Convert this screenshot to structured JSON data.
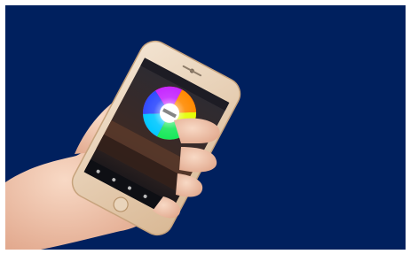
{
  "scene": {
    "background_color": "#00205e",
    "phone_body_color": "#e6c9a8",
    "screen_background": "#1a1a22",
    "hand_skin_color": "#f2c8b0",
    "color_wheel_center_color": "#ffffff"
  }
}
